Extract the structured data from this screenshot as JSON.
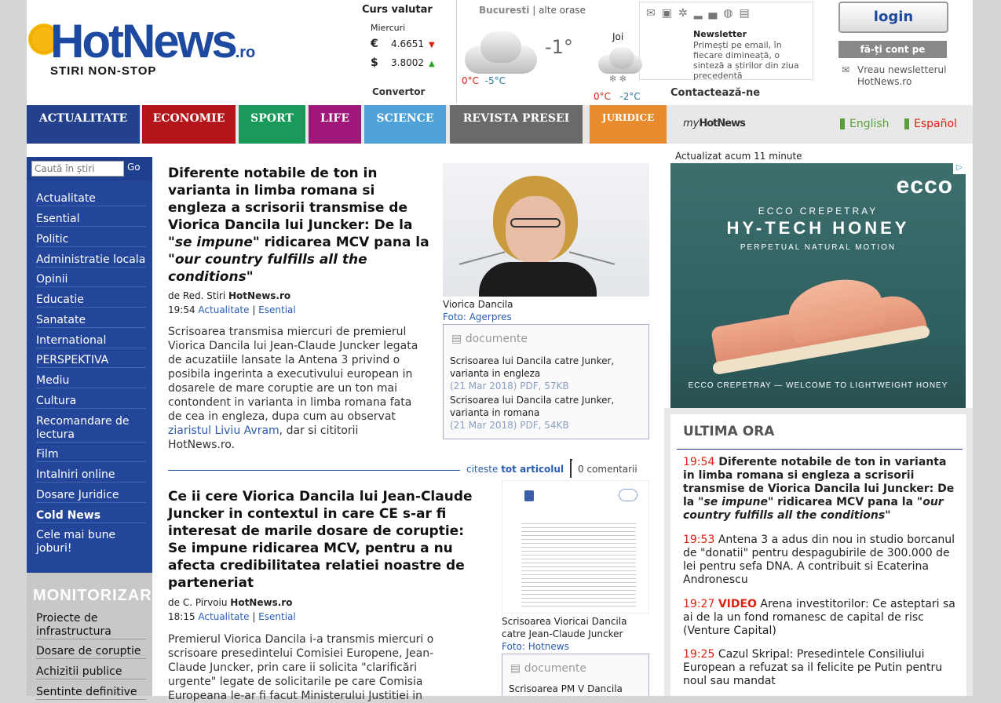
{
  "header": {
    "logo_name": "HotNews",
    "logo_tld": ".ro",
    "logo_tagline": "STIRI NON-STOP",
    "fx": {
      "title": "Curs valutar",
      "day": "Miercuri",
      "rates": [
        {
          "currency_icon": "euro-icon",
          "symbol": "€",
          "value": "4.6651",
          "trend": "down"
        },
        {
          "currency_icon": "dollar-icon",
          "symbol": "$",
          "value": "3.8002",
          "trend": "up"
        }
      ],
      "converter": "Convertor"
    },
    "weather": {
      "city": "Bucuresti",
      "other": "alte orase",
      "temp_now": "-1°",
      "today_hi": "0°C",
      "today_lo": "-5°C",
      "next_day": "Joi",
      "next_hi": "0°C",
      "next_lo": "-2°C"
    },
    "newsletter": {
      "title": "Newsletter",
      "text": "Primești pe email, în fiecare dimineață, o sinteză a știrilor din ziua precedentă"
    },
    "contact": "Contactează-ne",
    "login": "login",
    "signup": "fă-ți cont pe Hotnews",
    "want_newsletter": "Vreau newsletterul HotNews.ro"
  },
  "nav": {
    "tabs": [
      {
        "label": "ACTUALITATE",
        "color": "#23418c"
      },
      {
        "label": "ECONOMIE",
        "color": "#b3151b"
      },
      {
        "label": "SPORT",
        "color": "#1a9a5a"
      },
      {
        "label": "LIFE",
        "color": "#a0177a"
      },
      {
        "label": "SCIENCE",
        "color": "#4fa2d8"
      },
      {
        "label": "REVISTA PRESEI",
        "color": "#6a6a6a"
      },
      {
        "label": "JURIDICE",
        "color": "#e88a2e"
      }
    ],
    "my": "my",
    "my_brand": "HotNews",
    "lang_en": "English",
    "lang_es": "Español"
  },
  "sidebar": {
    "search_placeholder": "Caută în știri",
    "go": "Go",
    "items": [
      "Actualitate",
      "Esential",
      "Politic",
      "Administratie locala",
      "Opinii",
      "Educatie",
      "Sanatate",
      "International",
      "PERSPEKTIVA",
      "Mediu",
      "Cultura",
      "Recomandare de lectura",
      "Film",
      "Intalniri online",
      "Dosare Juridice",
      "Cold News",
      "Cele mai bune joburi!"
    ],
    "monitor_logo": "MONITORIZARI",
    "monitor_items": [
      "Proiecte de infrastructura",
      "Dosare de coruptie",
      "Achizitii publice",
      "Sentinte definitive"
    ]
  },
  "article1": {
    "title_a": "Diferente notabile de ton in varianta in limba romana si engleza a scrisorii transmise de Viorica Dancila lui Juncker: De la \"",
    "title_i1": "se impune",
    "title_b": "\" ridicarea MCV pana la \"",
    "title_i2": "our country fulfills all the conditions",
    "title_c": "\"",
    "by_prefix": "de Red. Stiri",
    "by_site": "HotNews.ro",
    "time": "19:54",
    "cat1": "Actualitate",
    "cat2": "Esential",
    "body_a": "Scrisoarea transmisa miercuri de premierul Viorica Dancila lui Jean-Claude Juncker legata de acuzatiile lansate la Antena 3 privind o posibila ingerinta a executivului european in dosarele de mare coruptie are un ton mai contondent in varianta in limba romana fata de cea in engleza, dupa cum au observat",
    "body_link": "ziaristul Liviu Avram",
    "body_b": ", dar si cititorii HotNews.ro.",
    "photo_caption": "Viorica Dancila",
    "photo_credit": "Foto: Agerpres",
    "docs_title": "documente",
    "docs": [
      {
        "name": "Scrisoarea lui Dancila catre Junker, varianta in engleza",
        "meta": "(21 Mar 2018) PDF, 57KB"
      },
      {
        "name": "Scrisoarea lui Dancila catre Junker, varianta in romana",
        "meta": "(21 Mar 2018) PDF, 54KB"
      }
    ],
    "read_prefix": "citeste",
    "read_link": "tot articolul",
    "comments": "0 comentarii"
  },
  "article2": {
    "title": "Ce ii cere Viorica Dancila lui Jean-Claude Juncker in contextul in care CE s-ar fi interesat de marile dosare de coruptie: Se impune ridicarea MCV, pentru a nu afecta credibilitatea relatiei noastre de parteneriat",
    "by_prefix": "de C. Pirvoiu",
    "by_site": "HotNews.ro",
    "time": "18:15",
    "cat1": "Actualitate",
    "cat2": "Esential",
    "body": "Premierul Viorica Dancila i-a transmis miercuri o scrisoare presedintelui Comisiei Europene, Jean-Claude Juncker, prin care ii solicita \"clarificări urgente\" legate de solicitarile pe care Comisia Europeana le-ar fi facut Ministerului Justitiei in",
    "photo_caption": "Scrisoarea Vioricai Dancila catre Jean-Claude Juncker",
    "photo_credit": "Foto: Hotnews",
    "docs_title": "documente",
    "doc1": "Scrisoarea PM V Dancila"
  },
  "right": {
    "updated": "Actualizat acum 11 minute",
    "ad": {
      "brand": "ecco",
      "line1": "ECCO CREPETRAY",
      "line2": "HY-TECH HONEY",
      "line3": "PERPETUAL NATURAL MOTION",
      "line4": "ECCO CREPETRAY — WELCOME TO LIGHTWEIGHT HONEY"
    },
    "ultima_title": "ULTIMA ORA",
    "news": [
      {
        "time": "19:54",
        "a": "Diferente notabile de ton in varianta in limba romana si engleza a scrisorii transmise de Viorica Dancila lui Juncker: De la \"",
        "i1": "se impune",
        "b": "\" ridicarea MCV pana la \"",
        "i2": "our country fulfills all the conditions",
        "c": "\""
      },
      {
        "time": "19:53",
        "text": "Antena 3 a adus din nou in studio borcanul de \"donatii\" pentru despagubirile de 300.000 de lei pentru sefa DNA. A contribuit si Ecaterina Andronescu"
      },
      {
        "time": "19:27",
        "tag": "VIDEO",
        "text": "Arena investitorilor: Ce asteptari sa ai de la un fond romanesc de capital de risc (Venture Capital)"
      },
      {
        "time": "19:25",
        "text": "Cazul Skripal: Presedintele Consiliului European a refuzat sa il felicite pe Putin pentru noul sau mandat"
      }
    ]
  }
}
